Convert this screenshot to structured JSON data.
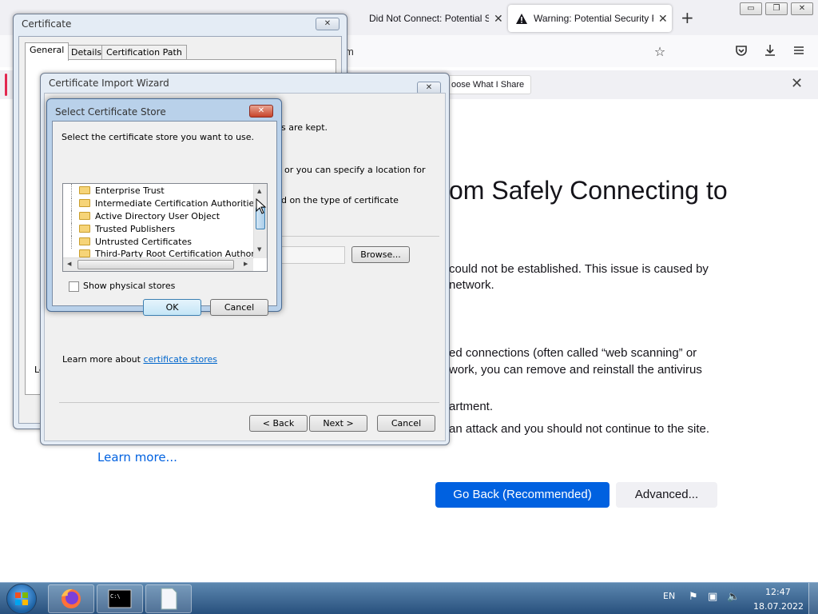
{
  "firefox": {
    "tabs": [
      {
        "title": "Did Not Connect: Potential Security Issue",
        "close": "✕"
      },
      {
        "title": "Warning: Potential Security Risk Ahead",
        "close": "✕"
      }
    ],
    "new_tab": "+",
    "window_controls": {
      "minimize": "▭",
      "restore": "❐",
      "close": "✕"
    },
    "url_fragment": "m",
    "notification": {
      "button": "oose What I Share",
      "close": "✕"
    },
    "error": {
      "title_fragment": "om Safely Connecting to",
      "para1_l1": "could not be established. This issue is caused by",
      "para1_l2": "network.",
      "para2_l1": "ed connections (often called “web scanning” or",
      "para2_l2": "work, you can remove and reinstall the antivirus",
      "para3": "artment.",
      "para4": "an attack and you should not continue to the site.",
      "learn_more": "Learn more...",
      "go_back": "Go Back (Recommended)",
      "advanced": "Advanced..."
    }
  },
  "certificate": {
    "title": "Certificate",
    "tabs": [
      "General",
      "Details",
      "Certification Path"
    ],
    "side_fragment": "Le"
  },
  "wizard": {
    "title": "Certificate Import Wizard",
    "text_kept": "s are kept.",
    "text_location": "or you can specify a location for",
    "text_type": "d on the type of certificate",
    "browse": "Browse...",
    "learn_prefix": "Learn more about ",
    "learn_link": "certificate stores",
    "back": "< Back",
    "next": "Next >",
    "cancel": "Cancel"
  },
  "store_dialog": {
    "title": "Select Certificate Store",
    "instruction": "Select the certificate store you want to use.",
    "stores": [
      "Enterprise Trust",
      "Intermediate Certification Authorities",
      "Active Directory User Object",
      "Trusted Publishers",
      "Untrusted Certificates",
      "Third-Party Root Certification Authorities"
    ],
    "show_physical": "Show physical stores",
    "show_physical_checked": false,
    "ok": "OK",
    "cancel": "Cancel"
  },
  "taskbar": {
    "language": "EN",
    "time": "12:47",
    "date": "18.07.2022"
  }
}
